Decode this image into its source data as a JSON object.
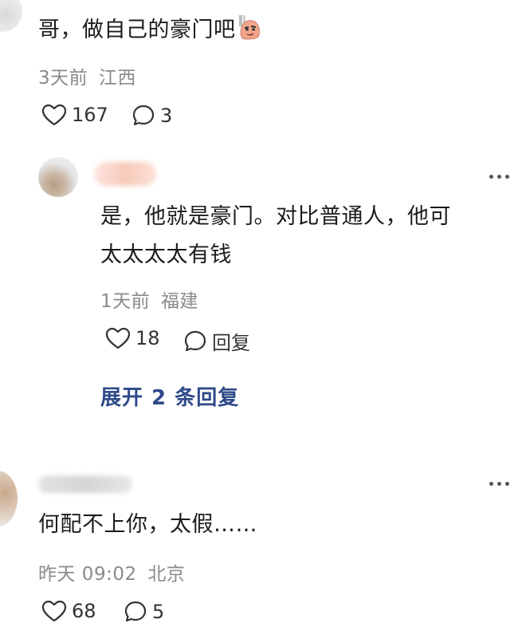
{
  "comments": [
    {
      "text": "哥，做自己的豪门吧",
      "emoji": "sly-face-emoji",
      "time": "3天前",
      "location": "江西",
      "likes": "167",
      "replies": "3"
    },
    {
      "text_line1": "是，他就是豪门。对比普通人，他可",
      "text_line2": "太太太太有钱",
      "time": "1天前",
      "location": "福建",
      "likes": "18",
      "reply_label": "回复"
    },
    {
      "text": "何配不上你，太假……",
      "time": "昨天 09:02",
      "location": "北京",
      "likes": "68",
      "replies": "5"
    }
  ],
  "expand_replies": "展开 2 条回复",
  "icons": {
    "like": "heart-outline-icon",
    "comment": "speech-bubble-icon",
    "more": "more-dots-icon"
  },
  "colors": {
    "expand_link": "#2f4a8a",
    "meta_text": "#8a8a8a"
  }
}
